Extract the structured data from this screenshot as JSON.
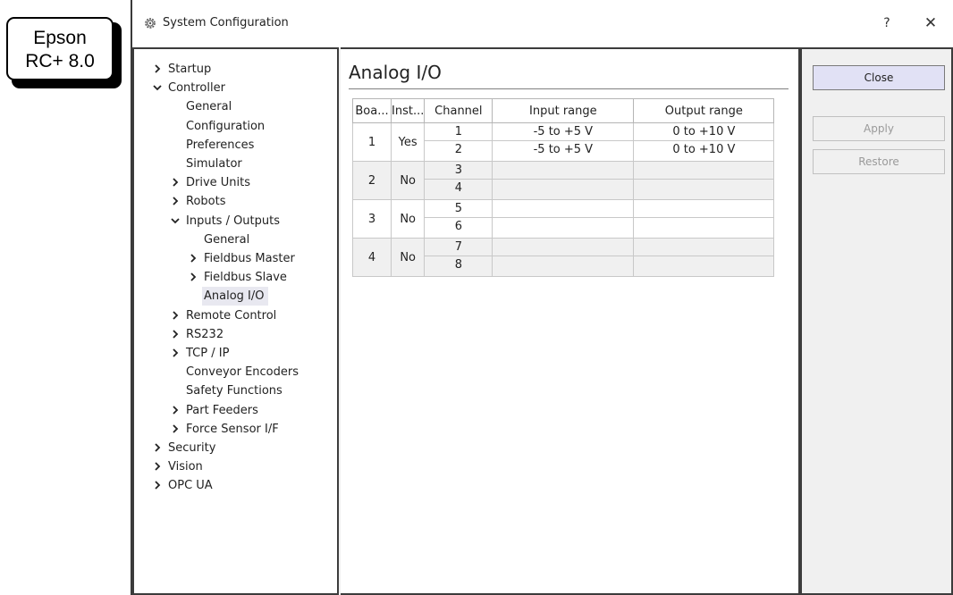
{
  "badge": {
    "line1": "Epson",
    "line2": "RC+ 8.0"
  },
  "window": {
    "title": "System Configuration",
    "help_label": "?",
    "close_label": "✕"
  },
  "tree": [
    {
      "label": "Startup",
      "level": 0,
      "chevron": ">"
    },
    {
      "label": "Controller",
      "level": 0,
      "chevron": "v"
    },
    {
      "label": "General",
      "level": 1,
      "chevron": ""
    },
    {
      "label": "Configuration",
      "level": 1,
      "chevron": ""
    },
    {
      "label": "Preferences",
      "level": 1,
      "chevron": ""
    },
    {
      "label": "Simulator",
      "level": 1,
      "chevron": ""
    },
    {
      "label": "Drive Units",
      "level": 1,
      "chevron": ">"
    },
    {
      "label": "Robots",
      "level": 1,
      "chevron": ">"
    },
    {
      "label": "Inputs / Outputs",
      "level": 1,
      "chevron": "v"
    },
    {
      "label": "General",
      "level": 2,
      "chevron": ""
    },
    {
      "label": "Fieldbus Master",
      "level": 2,
      "chevron": ">"
    },
    {
      "label": "Fieldbus Slave",
      "level": 2,
      "chevron": ">"
    },
    {
      "label": "Analog I/O",
      "level": 2,
      "chevron": "",
      "selected": true
    },
    {
      "label": "Remote Control",
      "level": 1,
      "chevron": ">"
    },
    {
      "label": "RS232",
      "level": 1,
      "chevron": ">"
    },
    {
      "label": "TCP / IP",
      "level": 1,
      "chevron": ">"
    },
    {
      "label": "Conveyor Encoders",
      "level": 1,
      "chevron": ""
    },
    {
      "label": "Safety Functions",
      "level": 1,
      "chevron": ""
    },
    {
      "label": "Part Feeders",
      "level": 1,
      "chevron": ">"
    },
    {
      "label": "Force Sensor I/F",
      "level": 1,
      "chevron": ">"
    },
    {
      "label": "Security",
      "level": 0,
      "chevron": ">"
    },
    {
      "label": "Vision",
      "level": 0,
      "chevron": ">"
    },
    {
      "label": "OPC UA",
      "level": 0,
      "chevron": ">"
    }
  ],
  "page": {
    "title": "Analog I/O"
  },
  "table": {
    "headers": [
      "Boa...",
      "Inst...",
      "Channel",
      "Input range",
      "Output range"
    ],
    "boards": [
      {
        "board": "1",
        "installed": "Yes",
        "channels": [
          {
            "channel": "1",
            "input": "-5 to +5 V",
            "output": "0 to +10 V"
          },
          {
            "channel": "2",
            "input": "-5 to +5 V",
            "output": "0 to +10 V"
          }
        ]
      },
      {
        "board": "2",
        "installed": "No",
        "channels": [
          {
            "channel": "3",
            "input": "",
            "output": ""
          },
          {
            "channel": "4",
            "input": "",
            "output": ""
          }
        ]
      },
      {
        "board": "3",
        "installed": "No",
        "channels": [
          {
            "channel": "5",
            "input": "",
            "output": ""
          },
          {
            "channel": "6",
            "input": "",
            "output": ""
          }
        ]
      },
      {
        "board": "4",
        "installed": "No",
        "channels": [
          {
            "channel": "7",
            "input": "",
            "output": ""
          },
          {
            "channel": "8",
            "input": "",
            "output": ""
          }
        ]
      }
    ]
  },
  "buttons": {
    "close": "Close",
    "apply": "Apply",
    "restore": "Restore"
  },
  "icons": {
    "title": "gear-icon",
    "chevron_collapsed": "chevron-right-icon",
    "chevron_expanded": "chevron-down-icon"
  }
}
